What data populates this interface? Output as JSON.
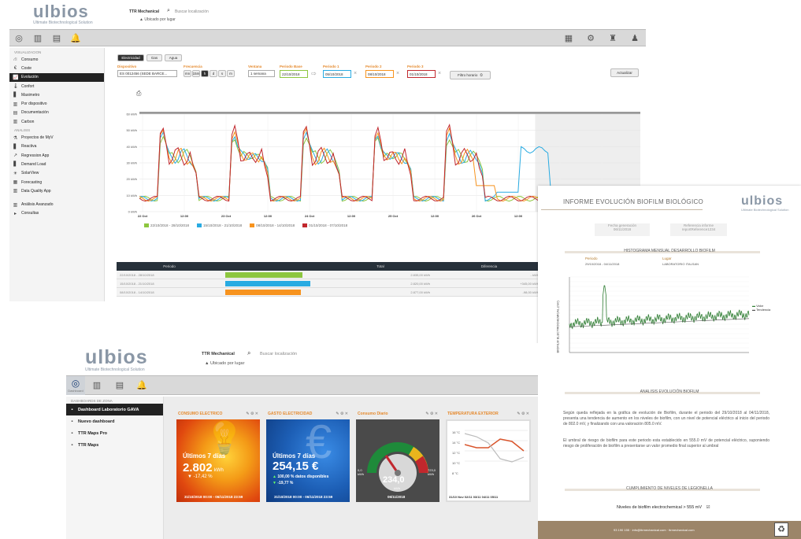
{
  "screen1": {
    "logo": {
      "text": "ulbios",
      "sub": "Ultimate Biotechnological Solution"
    },
    "header": {
      "app": "TTR Mechanical",
      "search_placeholder": "Buscar localización",
      "location": "Ubicado por lugar"
    },
    "sidebar": {
      "section1": "VISUALIZACION",
      "items1": [
        {
          "label": "Consumo",
          "icon": "network-icon"
        },
        {
          "label": "Coste",
          "icon": "euro-icon"
        },
        {
          "label": "Evolución",
          "icon": "chart-icon",
          "active": true
        },
        {
          "label": "Confort",
          "icon": "thermometer-icon"
        },
        {
          "label": "Maximetro",
          "icon": "bars-icon"
        },
        {
          "label": "Por dispositivo",
          "icon": "bar-icon"
        },
        {
          "label": "Documentación",
          "icon": "doc-icon"
        },
        {
          "label": "Carbon",
          "icon": "bar-icon"
        }
      ],
      "section2": "ANALISIS",
      "items2": [
        {
          "label": "Proyectos de MyV",
          "icon": "flask-icon"
        },
        {
          "label": "Reactiva",
          "icon": "bars-icon"
        },
        {
          "label": "Regression App",
          "icon": "line-icon"
        },
        {
          "label": "Demand Load",
          "icon": "bars-icon"
        },
        {
          "label": "SolarView",
          "icon": "sun-icon"
        },
        {
          "label": "Forecasting",
          "icon": "forecast-icon"
        },
        {
          "label": "Data Quality App",
          "icon": "bar-icon"
        }
      ],
      "items3": [
        {
          "label": "Análisis Avanzado",
          "icon": "bar-icon"
        },
        {
          "label": "Consultas",
          "icon": "caret-icon"
        }
      ]
    },
    "controls": {
      "tabs": [
        "Electricidad",
        "Gas",
        "Agua"
      ],
      "dispositivo_label": "Dispositivo",
      "dispositivo_value": "ES 0012456 (SEDE BARCE...",
      "frecuencia_label": "Frecuencia",
      "freq_options": [
        "mn",
        "15m",
        "h",
        "d",
        "s",
        "m"
      ],
      "ventana_label": "Ventana",
      "ventana_value": "1 semana",
      "base_label": "Periodo Base",
      "base_value": "22/10/2018",
      "p1_label": "Periodo 1",
      "p1_value": "05/10/2018",
      "p2_label": "Periodo 2",
      "p2_value": "08/10/2018",
      "p3_label": "Periodo 3",
      "p3_value": "01/10/2018",
      "filter": "Filtro horario",
      "update": "Actualizar"
    },
    "chart_data": {
      "type": "line",
      "yticks": [
        "60 kWh",
        "50 kWh",
        "40 kWh",
        "30 kWh",
        "20 kWh",
        "10 kWh",
        "0 kWh"
      ],
      "ylim": [
        0,
        60
      ],
      "xticks": [
        "22 Oct",
        "12:00",
        "23 Oct",
        "12:00",
        "24 Oct",
        "12:00",
        "25 Oct",
        "12:00",
        "26 Oct",
        "12:00",
        "27 Oct",
        "12:00"
      ],
      "series": [
        {
          "name": "22/10/2018 - 28/10/2018",
          "color": "#8dc63f"
        },
        {
          "name": "15/10/2018 - 21/10/2018",
          "color": "#29abe2"
        },
        {
          "name": "08/10/2018 - 14/10/2018",
          "color": "#f7931e"
        },
        {
          "name": "01/10/2018 - 07/10/2018",
          "color": "#c1272d"
        }
      ]
    },
    "table": {
      "headers": [
        "Periodo",
        "Total",
        "Diferencia"
      ],
      "rows": [
        {
          "period": "22/10/2018 - 28/10/2018",
          "total": "2.835,00 kWh",
          "diff": "- kWh",
          "color": "#8dc63f",
          "frac": 0.78
        },
        {
          "period": "15/10/2018 - 21/10/2018",
          "total": "2.820,00 kWh",
          "diff": "+345,00 kWh",
          "color": "#29abe2",
          "frac": 0.86
        },
        {
          "period": "08/10/2018 - 14/10/2018",
          "total": "2.877,00 kWh",
          "diff": "-98,00 kWh",
          "color": "#f7931e",
          "frac": 0.76
        }
      ]
    }
  },
  "screen2": {
    "logo": {
      "text": "ulbios",
      "sub": "Ultimate Biotechnological Solution"
    },
    "header": {
      "app": "TTR Mechanical",
      "search_placeholder": "Buscar localización",
      "location": "Ubicado por lugar"
    },
    "topicons": [
      "Dashboard",
      "",
      "",
      ""
    ],
    "sidebar": {
      "section": "DASHBOARDS DE ZONA",
      "items": [
        {
          "label": "Dashboard Laboratorio GAVA",
          "active": true
        },
        {
          "label": "Nuevo dashboard"
        },
        {
          "label": "TTR Maps Pro"
        },
        {
          "label": "TTR Maps"
        }
      ]
    },
    "tiles": [
      {
        "title": "CONSUMO ELECTRICO",
        "line1": "Últimos 7 días",
        "value": "2.802",
        "unit": "kWh",
        "change": "-17,42 %",
        "date": "31/10/2018 00:00 - 06/11/2018 23:59"
      },
      {
        "title": "GASTO ELECTRICIDAD",
        "line1": "Últimos 7 días",
        "value": "254,15 €",
        "change": "100,00 % datos disponibles",
        "change2": "-19,77 %",
        "date": "31/10/2018 00:00 - 06/11/2018 23:59"
      },
      {
        "title": "Consumo Diario",
        "value": "234,0",
        "unit": "kWh",
        "gmin": "0,0\nkWh",
        "gmax": "723,0\nkWh",
        "date": "06/11/2018"
      },
      {
        "title": "TEMPERATURA EXTERIOR",
        "yticks": [
          "16 °C",
          "14 °C",
          "12 °C",
          "10 °C",
          "8 °C"
        ],
        "xticks": "31/10 Nov 02/11 03/11 04/11 05/11"
      }
    ]
  },
  "report": {
    "title": "INFORME EVOLUCIÓN BIOFILM BIOLÓGICO",
    "logo": "ulbios",
    "logo_sub": "Ultimate Biotechnological Solution",
    "fecha_label": "Fecha generación",
    "fecha_value": "06/11/2018",
    "ref_label": "Referencia informe",
    "ref_value": "reportReference1234",
    "hist_title": "HISTOGRAMA MENSUAL DESARROLLO BIOFILM",
    "periodo_label": "Periodo",
    "periodo_value": "29/10/2018 - 04/11/2018",
    "lugar_label": "Lugar",
    "lugar_value": "LABORATORIO ITALSAN",
    "ylabel": "BIOFILM ELECTROCHEMICAL (mV)",
    "legend": [
      "Valor",
      "Tendencia"
    ],
    "analysis_title": "ANALISIS EVOLUCIÓN BIOFILM",
    "paragraph1": "Según queda reflejada en la gráfica de evolución de Biofilm, durante el periodo del 29/10/2018 al 04/11/2018, presenta una tendencia de aumento en los niveles de biofilm, con un nivel de potencial eléctrico al inicio del periodo de 802.0 mV, y finalizando con una valoración 805.0 mV.",
    "paragraph2": "El umbral de riesgo de biofilm para este periodo esta establecido en 555.0 mV de potencial eléctrico, suponiendo riesgo de proliferación de biofilm a presentarse un valor promedio final superior al umbral",
    "legionela_title": "CUMPLIMIENTO DE NIVELES DE LEGIONELLA",
    "niveles": "Niveles de biofilm electrochemical > 555 mV",
    "footer": "93 190 155 · info@ttrmechanical.com · ttrmechanical.com"
  }
}
